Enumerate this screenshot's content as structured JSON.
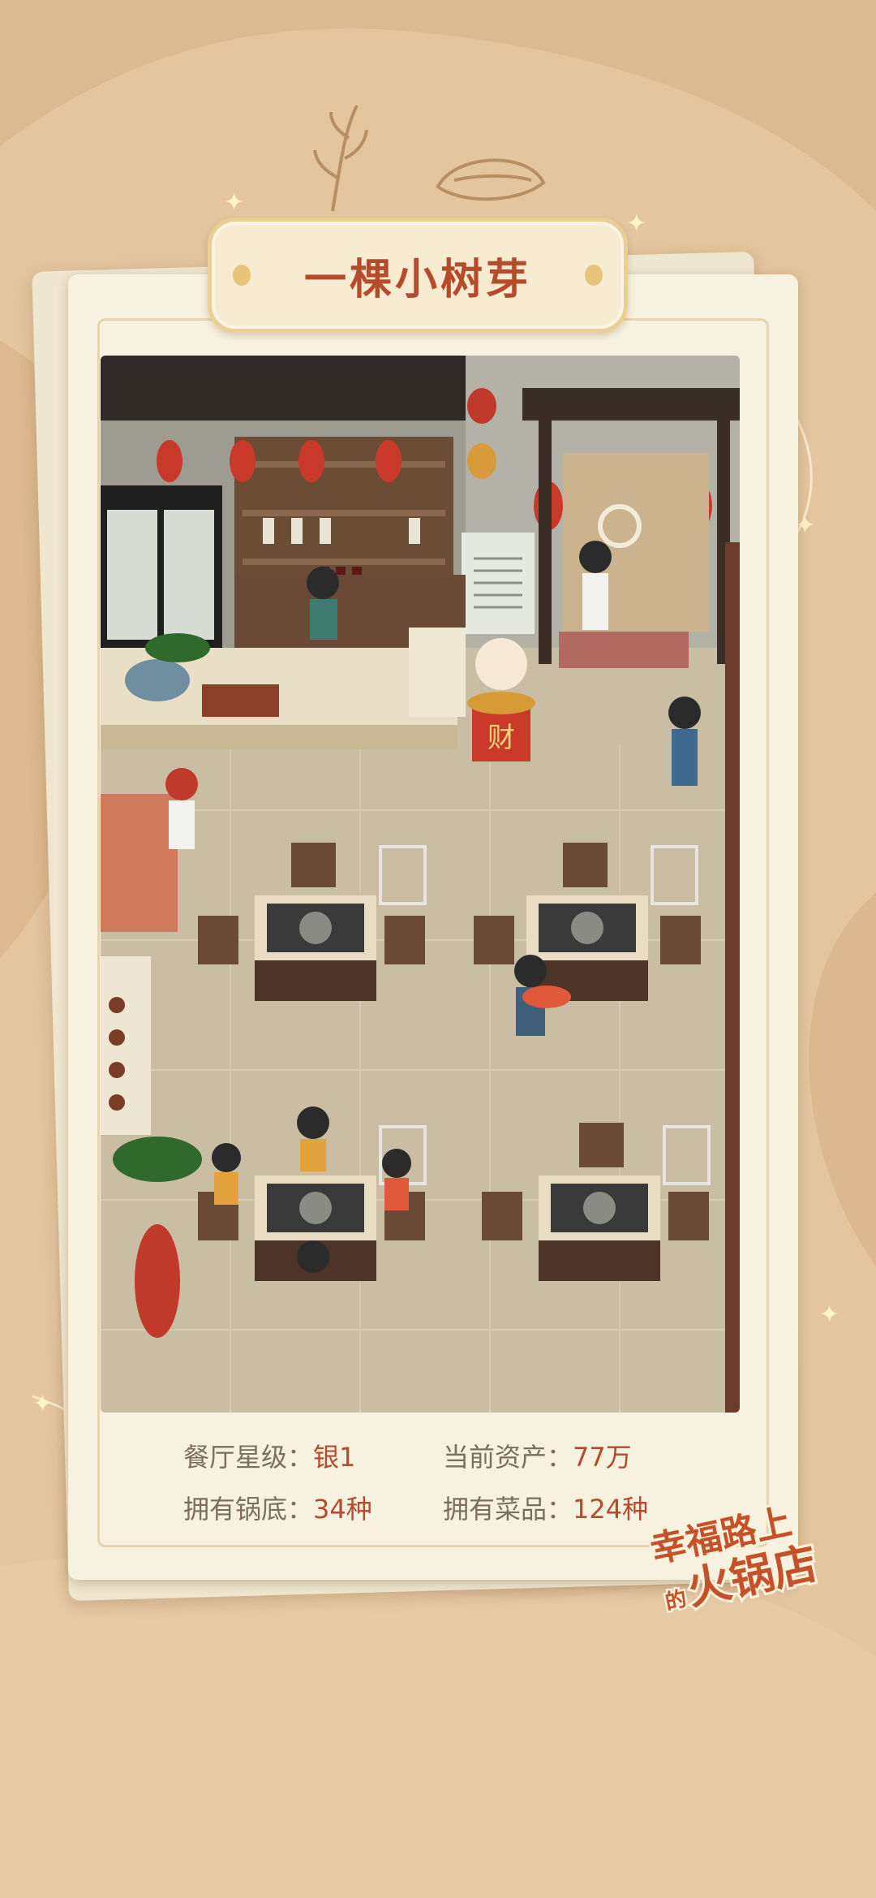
{
  "restaurant": {
    "name": "一棵小树芽"
  },
  "stats": [
    {
      "key": "star",
      "label": "餐厅星级：",
      "value": "银1"
    },
    {
      "key": "assets",
      "label": "当前资产：",
      "value": "77万"
    },
    {
      "key": "bases",
      "label": "拥有锅底：",
      "value": "34种"
    },
    {
      "key": "dishes",
      "label": "拥有菜品：",
      "value": "124种"
    }
  ],
  "scene": {
    "lucky_cat_sign": "财"
  },
  "logo": {
    "line1": "幸福路上",
    "line2_small": "的",
    "line2": "火锅店"
  },
  "colors": {
    "accent": "#b54a2c",
    "label": "#7e6e5c",
    "background": "#e3c59e",
    "card": "#f7f1e0",
    "banner_border": "#e9cf93"
  },
  "icons": [
    "star-sparkle-icon",
    "lucky-cat-icon",
    "wheat-sketch-icon",
    "dumpling-sketch-icon"
  ]
}
